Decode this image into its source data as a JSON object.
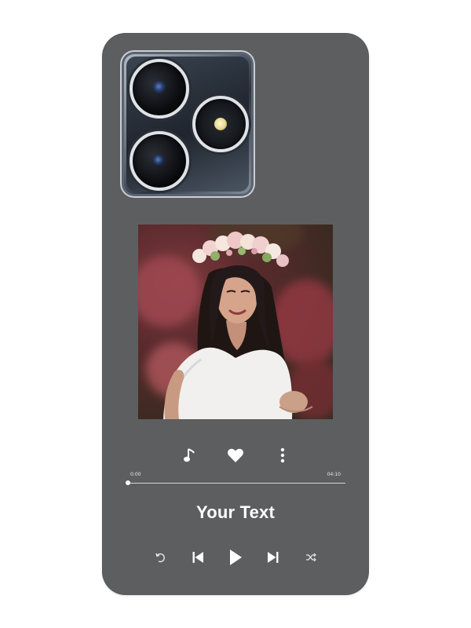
{
  "product": {
    "case_color": "#5d5e5f",
    "text_color": "#ffffff"
  },
  "player": {
    "elapsed": "0:00",
    "duration": "04:10",
    "progress": 0.0,
    "custom_text": "Your Text",
    "top_icons": [
      "music-note-icon",
      "heart-icon",
      "more-vertical-icon"
    ],
    "bottom_icons": [
      "repeat-icon",
      "previous-track-icon",
      "play-icon",
      "next-track-icon",
      "shuffle-icon"
    ]
  }
}
